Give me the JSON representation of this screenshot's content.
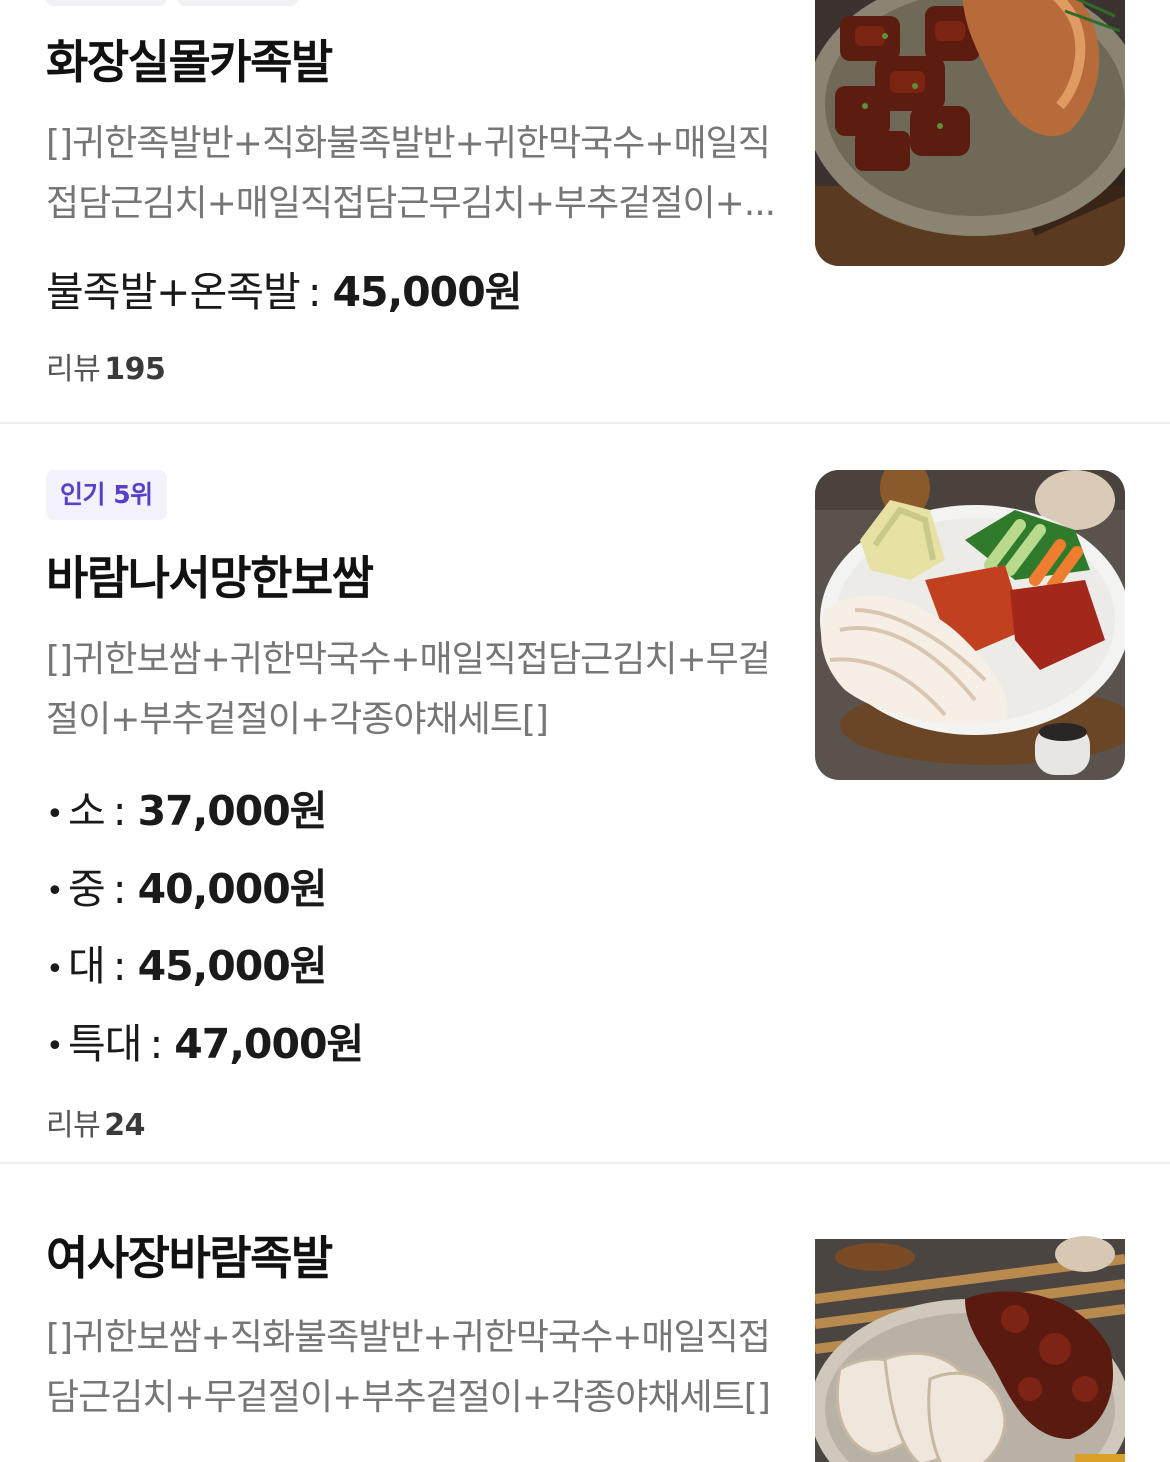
{
  "menu_items": [
    {
      "title": "화장실몰카족발",
      "description": "[]귀한족발반+직화불족발반+귀한막국수+매일직접담근김치+매일직접담근무김치+부추겉절이+...",
      "prices": [
        {
          "option": "불족발+온족발",
          "amount": "45,000원"
        }
      ],
      "review_label": "리뷰",
      "review_count": "195",
      "image_icon": "jokbal-photo"
    },
    {
      "badge": "인기 5위",
      "title": "바람나서망한보쌈",
      "description": "[]귀한보쌈+귀한막국수+매일직접담근김치+무겉절이+부추겉절이+각종야채세트[]",
      "prices": [
        {
          "option": "소",
          "amount": "37,000원"
        },
        {
          "option": "중",
          "amount": "40,000원"
        },
        {
          "option": "대",
          "amount": "45,000원"
        },
        {
          "option": "특대",
          "amount": "47,000원"
        }
      ],
      "review_label": "리뷰",
      "review_count": "24",
      "image_icon": "bossam-photo"
    },
    {
      "title": "여사장바람족발",
      "description": "[]귀한보쌈+직화불족발반+귀한막국수+매일직접담근김치+무겉절이+부추겉절이+각종야채세트[]",
      "image_icon": "bossam-jokbal-photo"
    }
  ],
  "colors": {
    "badge_text": "#5b3fc6",
    "badge_bg": "#f3f2fb",
    "description": "#767676",
    "divider": "#efeff1"
  }
}
